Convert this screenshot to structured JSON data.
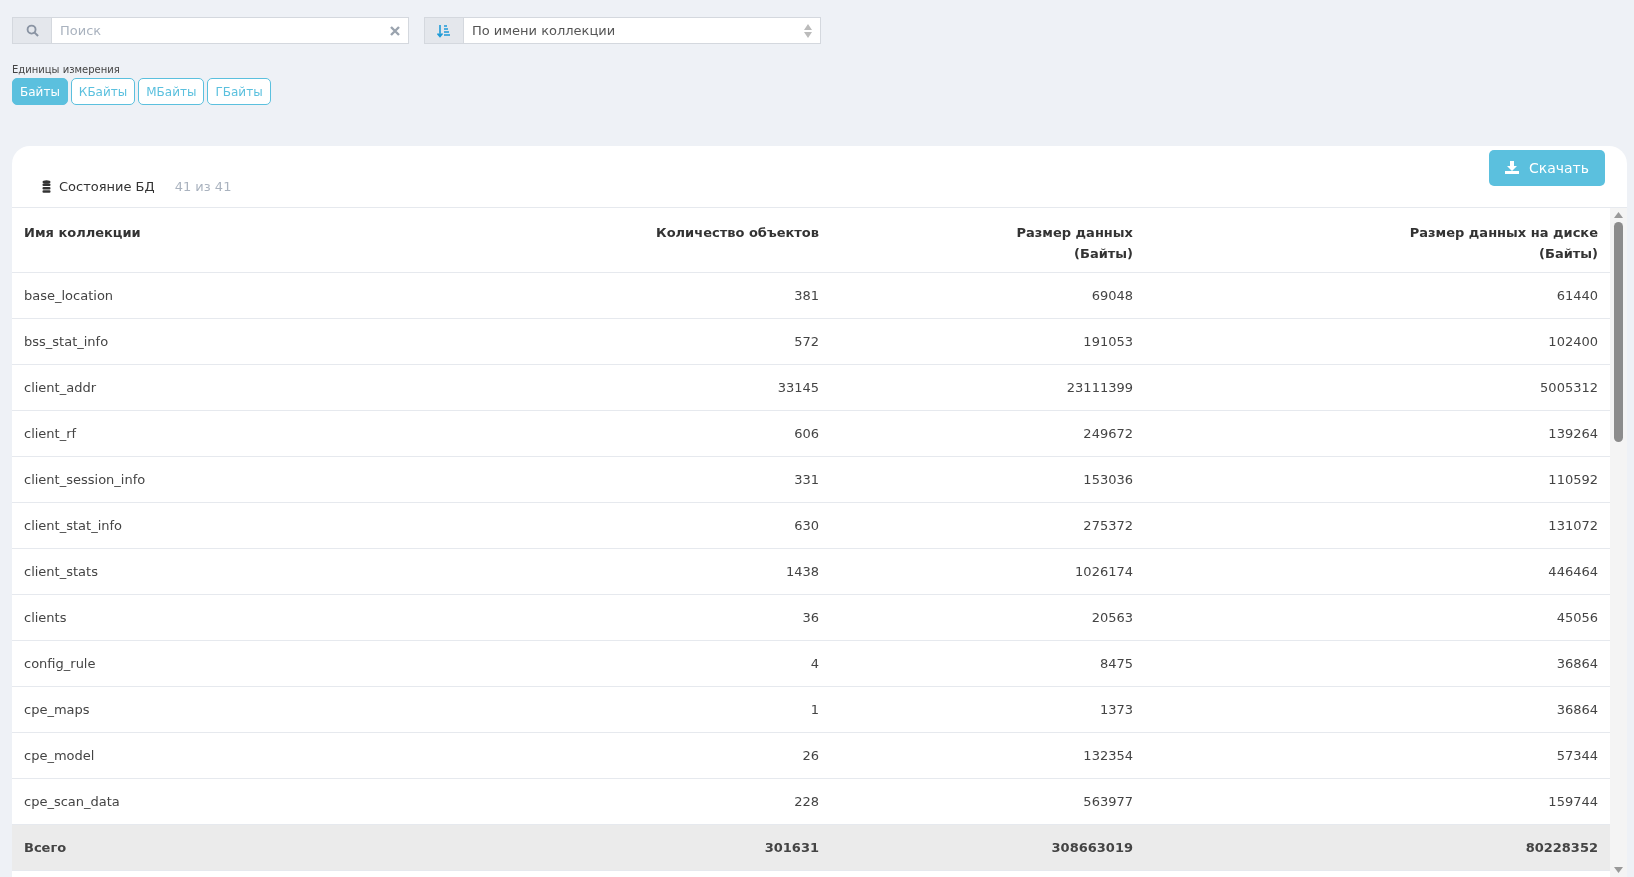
{
  "search": {
    "placeholder": "Поиск"
  },
  "sort": {
    "value": "По имени коллекции"
  },
  "units": {
    "label": "Единицы измерения",
    "options": [
      {
        "label": "Байты",
        "selected": true
      },
      {
        "label": "КБайты",
        "selected": false
      },
      {
        "label": "МБайты",
        "selected": false
      },
      {
        "label": "ГБайты",
        "selected": false
      }
    ]
  },
  "panel": {
    "title": "Состояние БД",
    "count": "41 из 41",
    "download_button": "Скачать"
  },
  "table": {
    "columns": [
      {
        "label": "Имя коллекции"
      },
      {
        "label": "Количество объектов"
      },
      {
        "label": "Размер данных",
        "sub": "(Байты)"
      },
      {
        "label": "Размер данных на диске",
        "sub": "(Байты)"
      }
    ],
    "rows": [
      [
        "base_location",
        "381",
        "69048",
        "61440"
      ],
      [
        "bss_stat_info",
        "572",
        "191053",
        "102400"
      ],
      [
        "client_addr",
        "33145",
        "23111399",
        "5005312"
      ],
      [
        "client_rf",
        "606",
        "249672",
        "139264"
      ],
      [
        "client_session_info",
        "331",
        "153036",
        "110592"
      ],
      [
        "client_stat_info",
        "630",
        "275372",
        "131072"
      ],
      [
        "client_stats",
        "1438",
        "1026174",
        "446464"
      ],
      [
        "clients",
        "36",
        "20563",
        "45056"
      ],
      [
        "config_rule",
        "4",
        "8475",
        "36864"
      ],
      [
        "cpe_maps",
        "1",
        "1373",
        "36864"
      ],
      [
        "cpe_model",
        "26",
        "132354",
        "57344"
      ],
      [
        "cpe_scan_data",
        "228",
        "563977",
        "159744"
      ]
    ],
    "total": [
      "Всего",
      "301631",
      "308663019",
      "80228352"
    ]
  }
}
